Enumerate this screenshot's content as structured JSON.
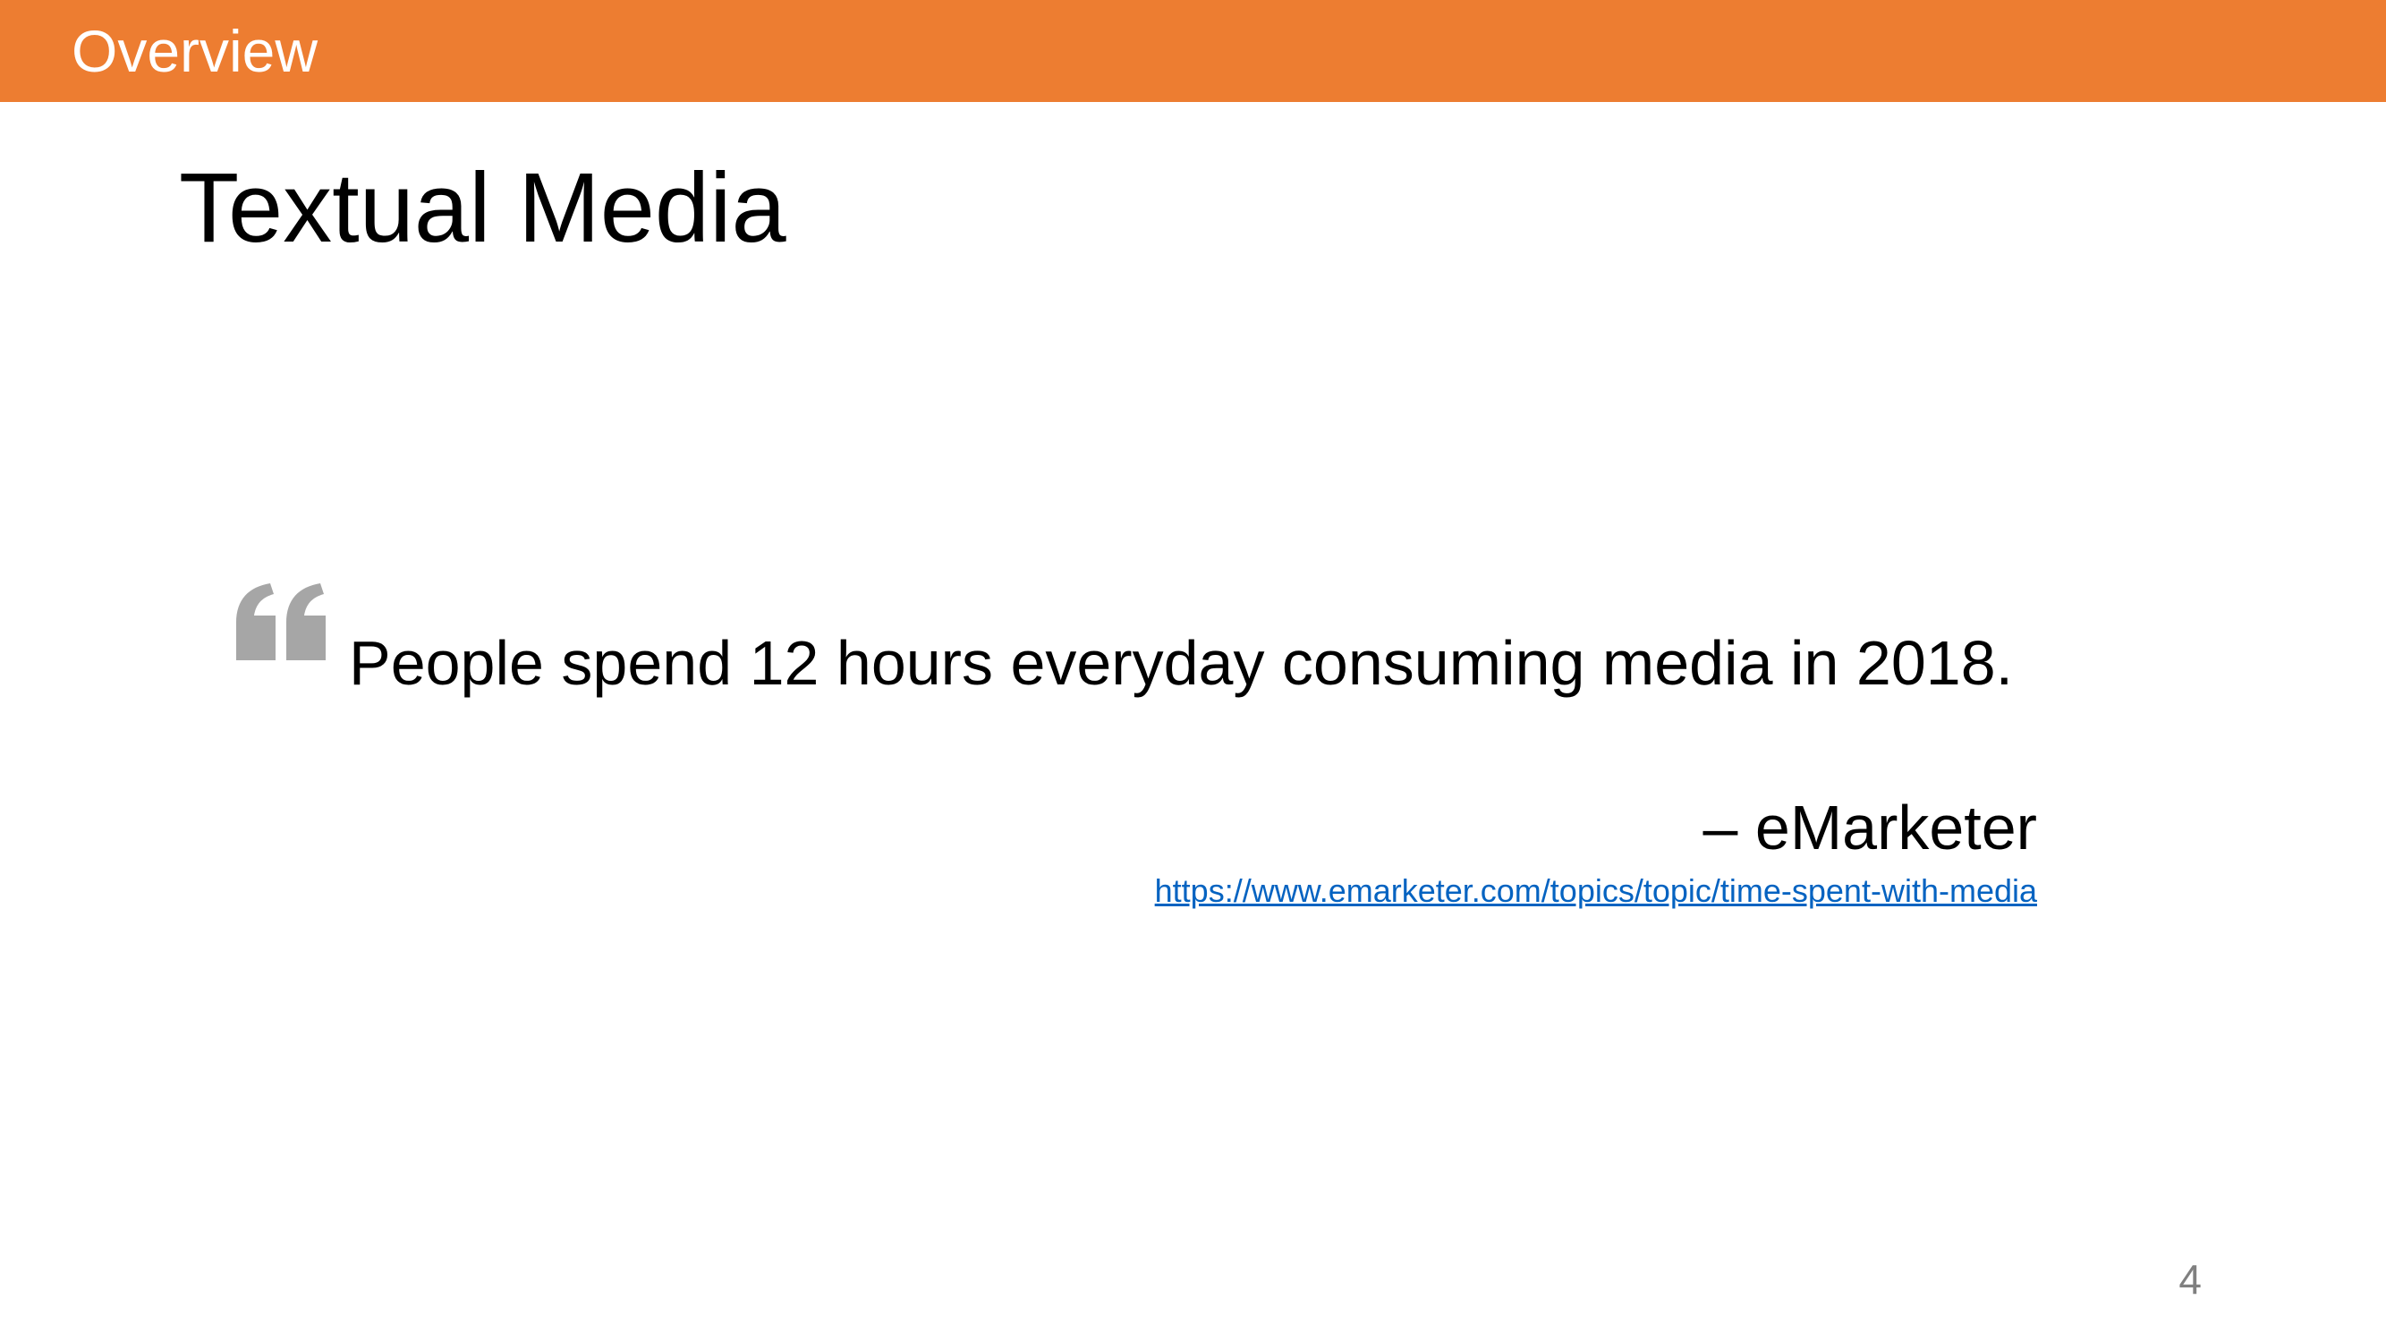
{
  "header": {
    "section_label": "Overview"
  },
  "slide": {
    "title": "Textual Media",
    "quote_icon": "quote-marks-icon",
    "quote": "People spend 12 hours everyday consuming media in 2018.",
    "attribution": "– eMarketer",
    "source_url": "https://www.emarketer.com/topics/topic/time-spent-with-media",
    "page_number": "4"
  },
  "colors": {
    "accent": "#ED7D31",
    "quote_icon": "#A6A6A6",
    "link": "#0563C1",
    "page_number": "#808080"
  }
}
